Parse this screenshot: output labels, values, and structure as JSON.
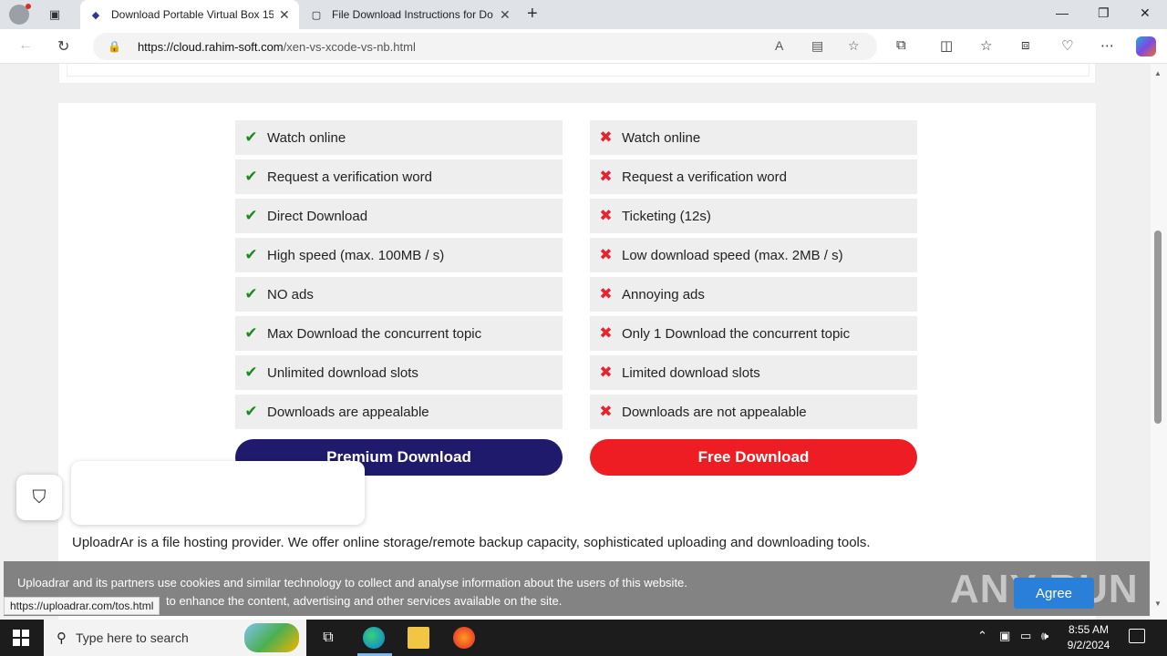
{
  "browser": {
    "tabs": [
      {
        "title": "Download Portable Virtual Box 15",
        "active": true
      },
      {
        "title": "File Download Instructions for Do",
        "active": false
      }
    ],
    "url_host": "https://cloud.rahim-soft.com",
    "url_path": "/xen-vs-xcode-vs-nb.html"
  },
  "premium_features": [
    "Watch online",
    "Request a verification word",
    "Direct Download",
    "High speed (max. 100MB / s)",
    "NO ads",
    "Max Download the concurrent topic",
    "Unlimited download slots",
    "Downloads are appealable"
  ],
  "free_features": [
    "Watch online",
    "Request a verification word",
    "Ticketing (12s)",
    "Low download speed (max. 2MB / s)",
    "Annoying ads",
    "Only 1 Download the concurrent topic",
    "Limited download slots",
    "Downloads are not appealable"
  ],
  "buttons": {
    "premium": "Premium Download",
    "free": "Free Download"
  },
  "description": "UploadrAr is a file hosting provider. We offer online storage/remote backup capacity, sophisticated uploading and downloading tools.",
  "cookie": {
    "line1": "Uploadrar and its partners use cookies and similar technology to collect and analyse information about the users of this website.",
    "line2": "to enhance the content, advertising and other services available on the site.",
    "agree": "Agree"
  },
  "status_url": "https://uploadrar.com/tos.html",
  "watermark": "ANY RUN",
  "taskbar": {
    "search_placeholder": "Type here to search",
    "time": "8:55 AM",
    "date": "9/2/2024"
  },
  "colors": {
    "premium_button": "#1f1a6b",
    "free_button": "#ee1d23",
    "check": "#1a8a1a",
    "cross": "#e8222e"
  }
}
